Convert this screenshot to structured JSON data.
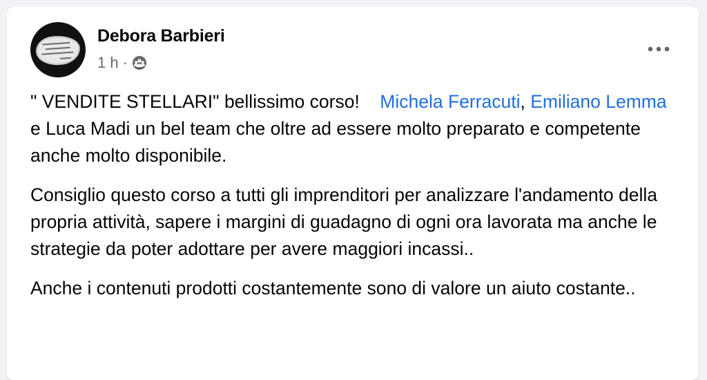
{
  "post": {
    "author": "Debora Barbieri",
    "time": "1 h",
    "separator": "·",
    "privacy_icon": "friends-icon",
    "more_icon": "more-options-icon",
    "p1_a": "\" VENDITE STELLARI\" bellissimo corso!",
    "mention_1": "Michela Ferracuti",
    "comma": ",",
    "mention_2": "Emiliano Lemma",
    "p1_b": " e Luca Madi un bel team che oltre ad essere molto preparato e competente anche molto disponibile.",
    "p2": "Consiglio questo corso a tutti gli imprenditori per analizzare l'andamento della propria attività, sapere i margini di guadagno di ogni ora lavorata ma anche le strategie da poter adottare per avere maggiori incassi..",
    "p3": "Anche i contenuti prodotti costantemente sono di valore un aiuto costante..",
    "mention_color": "#216fdb"
  }
}
